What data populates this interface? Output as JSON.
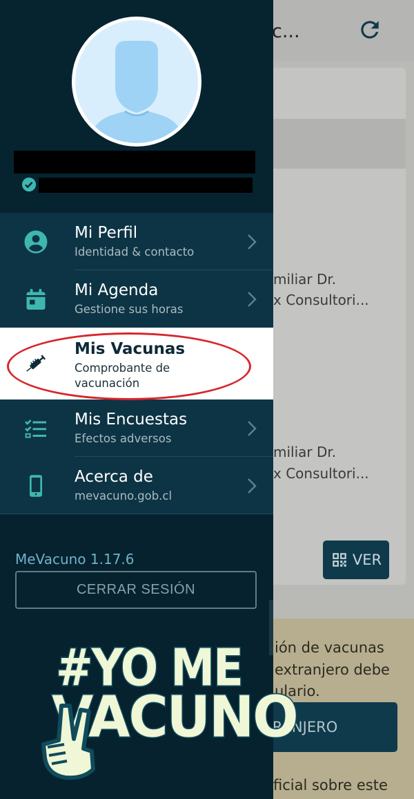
{
  "background": {
    "header_title": "c...",
    "card_lines": [
      "miliar Dr.",
      "x Consultori...",
      "miliar Dr.",
      "x Consultori..."
    ],
    "ver_button": "VER",
    "notice_lines": [
      "ión de vacunas",
      "extranjero debe",
      "ulario."
    ],
    "extranjero_button": "TRANJERO",
    "bottom_text": "ficial sobre este"
  },
  "drawer": {
    "menu": [
      {
        "label": "Mi Perfil",
        "sub": "Identidad & contacto",
        "icon": "account-circle-icon"
      },
      {
        "label": "Mi Agenda",
        "sub": "Gestione sus horas",
        "icon": "calendar-icon"
      },
      {
        "label": "Mis Vacunas",
        "sub": "Comprobante de vacunación",
        "sub1": "Comprobante de",
        "sub2": "vacunación",
        "icon": "syringe-icon"
      },
      {
        "label": "Mis Encuestas",
        "sub": "Efectos adversos",
        "icon": "checklist-icon"
      },
      {
        "label": "Acerca de",
        "sub": "mevacuno.gob.cl",
        "icon": "smartphone-icon"
      }
    ],
    "version": "MeVacuno 1.17.6",
    "logout_label": "CERRAR SESIÓN",
    "badge_line1": "#YO ME",
    "badge_line2": "VACUNO"
  },
  "colors": {
    "drawer_bg": "#06222e",
    "menu_bg": "#0d3444",
    "accent_teal": "#3fb7b0",
    "highlight_red": "#d8262b"
  }
}
